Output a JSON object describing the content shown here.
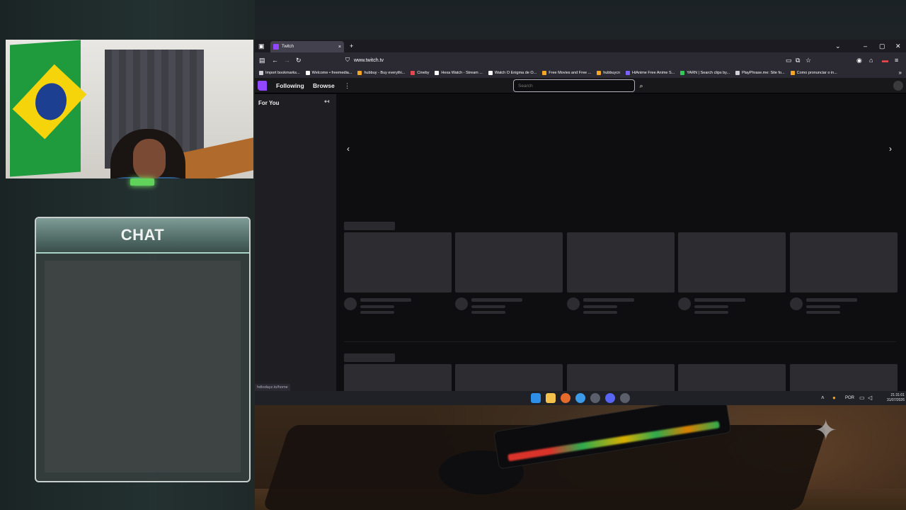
{
  "webcam": {},
  "chat": {
    "title": "CHAT"
  },
  "browser": {
    "tab": {
      "title": "Twitch",
      "close_icon": "×"
    },
    "new_tab_icon": "+",
    "url": "www.twitch.tv",
    "bookmarks": [
      {
        "label": "Import bookmarks...",
        "color": "#cfcfd8"
      },
      {
        "label": "Welcome • freemedia...",
        "color": "#ffffff"
      },
      {
        "label": "hubbuy - Buy everythi...",
        "color": "#f5a623"
      },
      {
        "label": "Cineby",
        "color": "#e5484d"
      },
      {
        "label": "Hexa Watch - Stream ...",
        "color": "#ffffff"
      },
      {
        "label": "Watch O Enigma de O...",
        "color": "#ffffff"
      },
      {
        "label": "Free Movies and Free ...",
        "color": "#f5a623"
      },
      {
        "label": "hubbuycn",
        "color": "#f5a623"
      },
      {
        "label": "HiAnime Free Anime S...",
        "color": "#7b61ff"
      },
      {
        "label": "YARN | Search clips by...",
        "color": "#34c759"
      },
      {
        "label": "PlayPhrase.me: Site fo...",
        "color": "#cfcfd8"
      },
      {
        "label": "Como pronunciar o in...",
        "color": "#f5a623"
      }
    ],
    "status_url": "hdtodayz.to/home"
  },
  "twitch": {
    "nav": {
      "following": "Following",
      "browse": "Browse"
    },
    "search_placeholder": "Search",
    "sidebar_title": "For You",
    "brand_color": "#9146ff"
  },
  "taskbar": {
    "language": "POR",
    "time": "21:31:01",
    "date": "31/07/2026"
  }
}
